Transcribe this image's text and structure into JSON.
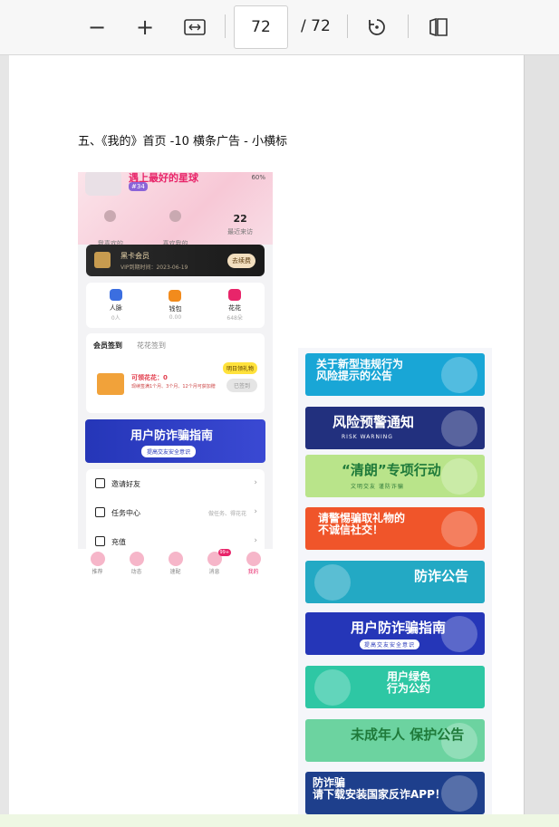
{
  "toolbar": {
    "zoom_out": "−",
    "zoom_in": "+",
    "page_current": "72",
    "page_total": "/ 72"
  },
  "document": {
    "heading": "五、《我的》首页 -10 横条广告 - 小横标"
  },
  "phone": {
    "title": "遇上最好的星球",
    "tag": "#34",
    "status": "60%",
    "stats": [
      {
        "num": "",
        "label": "我喜欢的"
      },
      {
        "num": "",
        "label": "喜欢我的"
      },
      {
        "num": "22",
        "label": "最近来访"
      }
    ],
    "vip": {
      "title": "黑卡会员",
      "expire": "VIP到期时间：2023-06-19",
      "button": "去续费"
    },
    "menu": [
      {
        "label": "人脉",
        "sub": "0人",
        "color": "#3b6ee0"
      },
      {
        "label": "钱包",
        "sub": "0.00",
        "color": "#f28b1c"
      },
      {
        "label": "花花",
        "sub": "648朵",
        "color": "#e8256a"
      }
    ],
    "sign": {
      "tab_active": "会员签到",
      "tab_other": "花花签到",
      "flowers": "可领花花：0",
      "desc": "现续签满1个月、3个月、12个月可获加赠",
      "badge": "明日领礼物",
      "button": "已签到"
    },
    "banner": {
      "title": "用户防诈骗指南",
      "sub": "提高交友安全意识"
    },
    "list": [
      {
        "label": "邀请好友",
        "right": ""
      },
      {
        "label": "任务中心",
        "right": "做任务、得花花"
      },
      {
        "label": "充值",
        "right": ""
      }
    ],
    "nav": [
      "推荐",
      "动态",
      "速配",
      "消息",
      "我的"
    ],
    "nav_badge": "99+"
  },
  "banners": [
    {
      "text": "关于新型违规行为\n风险提示的公告",
      "bg": "#19a6d6"
    },
    {
      "text": "风险预警通知",
      "sub": "RISK WARNING",
      "bg": "#22307e"
    },
    {
      "text": "“清朗”专项行动",
      "sub": "文明交友 谨防诈骗",
      "bg": "#b9e48a"
    },
    {
      "text": "请警惕骗取礼物的\n不诚信社交！",
      "bg": "#f0552a"
    },
    {
      "text": "防诈公告",
      "bg": "#23a9c4"
    },
    {
      "text": "用户防诈骗指南",
      "sub": "提高交友安全意识",
      "bg": "#2536b8"
    },
    {
      "text": "用户绿色\n行为公约",
      "bg": "#2ec7a4"
    },
    {
      "text": "未成年人 保护公告",
      "bg": "#6cd3a0"
    },
    {
      "text": "防诈骗\n请下载安装国家反诈APP！",
      "bg": "#1e3f8c"
    }
  ],
  "colors": {
    "accent": "#e8256a",
    "toolbar_bg": "#f7f7f7"
  }
}
